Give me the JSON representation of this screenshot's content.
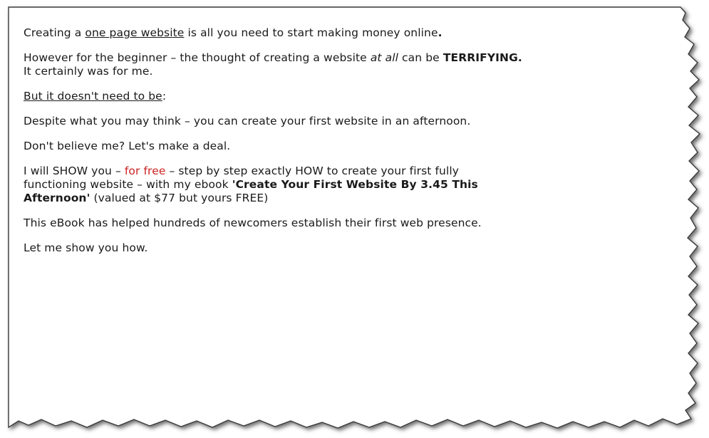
{
  "colors": {
    "paper": "#ffffff",
    "text": "#1a1a1a",
    "accent_red": "#cc2222",
    "torn_edge_shadow": "#4a4a4a"
  },
  "paragraphs": {
    "p1": {
      "a": "Creating a ",
      "link": "one page website",
      "b": " is all you need to start making money online",
      "end": "."
    },
    "p2": {
      "a": "However for the beginner – the thought of creating a website ",
      "em": "at all",
      "b": " can be ",
      "strong": "TERRIFYING.",
      "line2": "It certainly was for me."
    },
    "p3": {
      "a": "But it doesn't need to be",
      "b": ":"
    },
    "p4": {
      "text": "Despite what you may think – you can create your first website in an afternoon."
    },
    "p5": {
      "text": "Don't believe me?  Let's make a deal."
    },
    "p6": {
      "a": "I will SHOW you – ",
      "red": "for free",
      "b": " – step by step exactly HOW to create your first fully",
      "line2": "functioning website – with my ebook ",
      "title1": "'Create Your First Website By 3.45 This",
      "title2": "Afternoon'",
      "c": " (valued at $77 but yours FREE)"
    },
    "p7": {
      "text": "This eBook has helped hundreds of newcomers establish their first web presence."
    },
    "p8": {
      "text": "Let me show you how."
    }
  }
}
